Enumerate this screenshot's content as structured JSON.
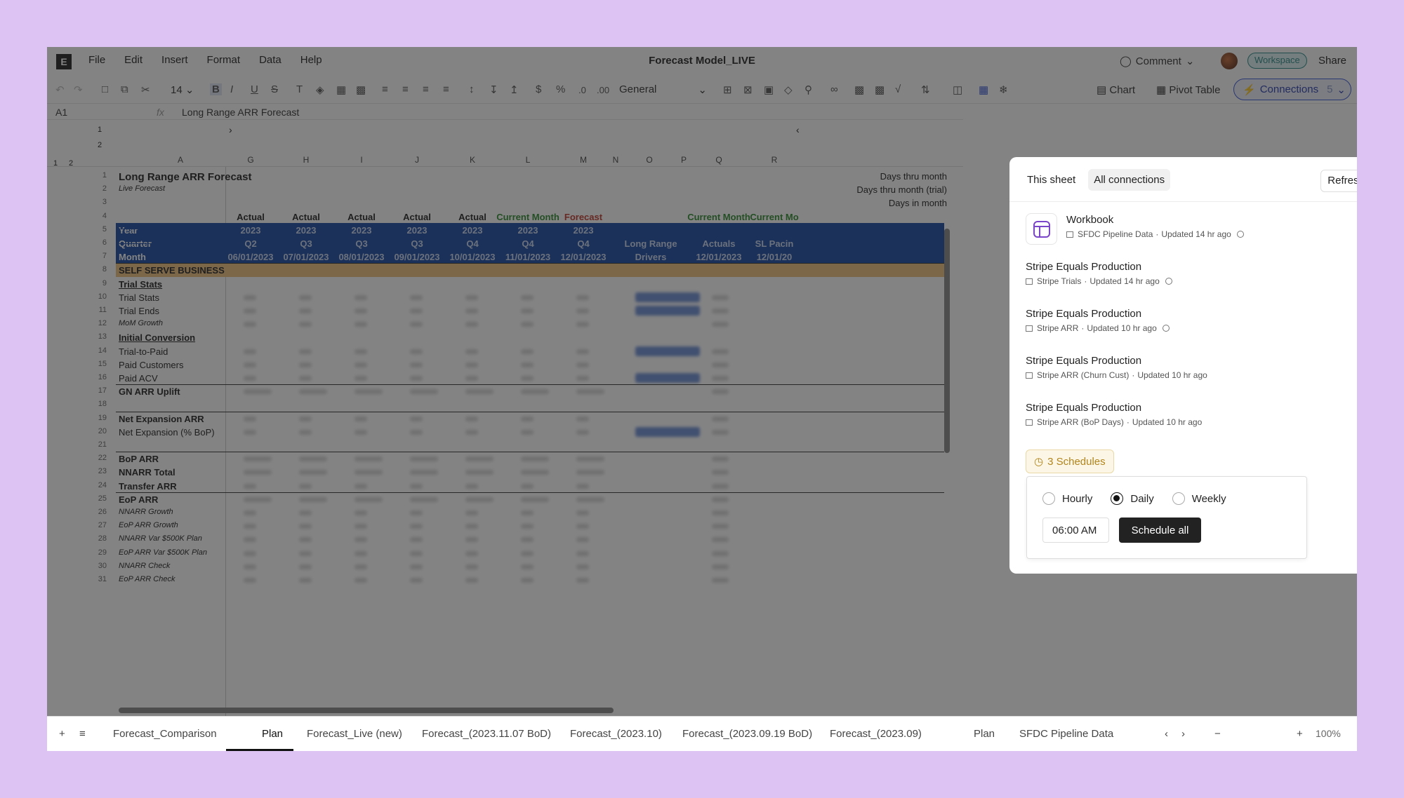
{
  "menubar": {
    "items": [
      "File",
      "Edit",
      "Insert",
      "Format",
      "Data",
      "Help"
    ],
    "title": "Forecast Model_LIVE",
    "comment": "Comment",
    "workspace": "Workspace",
    "share": "Share"
  },
  "toolbar": {
    "font_size": "14",
    "number_format": "General",
    "decimals_less": ".0",
    "decimals_more": ".00",
    "chart": "Chart",
    "pivot": "Pivot Table",
    "connections": "Connections",
    "connections_count": "5"
  },
  "formula": {
    "cell": "A1",
    "fx": "fx",
    "value": "Long Range ARR Forecast"
  },
  "grid": {
    "outline_levels": [
      "1",
      "2"
    ],
    "columns": [
      "A",
      "G",
      "H",
      "I",
      "J",
      "K",
      "L",
      "M",
      "N",
      "O",
      "P",
      "Q",
      "R"
    ],
    "header_row_numbers": [
      "1",
      "2"
    ],
    "rows": [
      {
        "n": "1",
        "a": "Long Range ARR Forecast"
      },
      {
        "n": "2",
        "a": "Live Forecast"
      },
      {
        "n": "3",
        "a": ""
      },
      {
        "n": "4",
        "a": ""
      },
      {
        "n": "5",
        "a": "Year"
      },
      {
        "n": "6",
        "a": "Quarter"
      },
      {
        "n": "7",
        "a": "Month"
      },
      {
        "n": "8",
        "a": "SELF SERVE BUSINESS"
      },
      {
        "n": "9",
        "a": "Trial Stats"
      },
      {
        "n": "10",
        "a": "Trial Stats"
      },
      {
        "n": "11",
        "a": "Trial Ends"
      },
      {
        "n": "12",
        "a": "MoM Growth"
      },
      {
        "n": "13",
        "a": "Initial Conversion"
      },
      {
        "n": "14",
        "a": "Trial-to-Paid"
      },
      {
        "n": "15",
        "a": "Paid Customers"
      },
      {
        "n": "16",
        "a": "Paid ACV"
      },
      {
        "n": "17",
        "a": "GN ARR Uplift"
      },
      {
        "n": "18",
        "a": ""
      },
      {
        "n": "19",
        "a": "Net Expansion ARR"
      },
      {
        "n": "20",
        "a": "Net Expansion (% BoP)"
      },
      {
        "n": "21",
        "a": ""
      },
      {
        "n": "22",
        "a": "BoP ARR"
      },
      {
        "n": "23",
        "a": "NNARR Total"
      },
      {
        "n": "24",
        "a": "Transfer ARR"
      },
      {
        "n": "25",
        "a": "EoP ARR"
      },
      {
        "n": "26",
        "a": "NNARR Growth"
      },
      {
        "n": "27",
        "a": "EoP ARR Growth"
      },
      {
        "n": "28",
        "a": "NNARR Var $500K Plan"
      },
      {
        "n": "29",
        "a": "EoP ARR Var $500K Plan"
      },
      {
        "n": "30",
        "a": "NNARR Check"
      },
      {
        "n": "31",
        "a": "EoP ARR Check"
      }
    ],
    "right_labels": [
      "Days thru month",
      "Days thru month (trial)",
      "Days in month"
    ],
    "status_row": [
      "Actual",
      "Actual",
      "Actual",
      "Actual",
      "Actual",
      "Current Month",
      "Forecast"
    ],
    "status_right": [
      "Current Month",
      "Current Mo"
    ],
    "years": [
      "2023",
      "2023",
      "2023",
      "2023",
      "2023",
      "2023",
      "2023"
    ],
    "quarters": [
      "Q2",
      "Q3",
      "Q3",
      "Q3",
      "Q4",
      "Q4",
      "Q4"
    ],
    "months": [
      "06/01/2023",
      "07/01/2023",
      "08/01/2023",
      "09/01/2023",
      "10/01/2023",
      "11/01/2023",
      "12/01/2023"
    ],
    "band_right_top": [
      "Long Range",
      "Actuals",
      "SL Pacin"
    ],
    "band_right_bottom": [
      "Drivers",
      "12/01/2023",
      "12/01/20"
    ],
    "colors": {
      "actual": "#222222",
      "current": "#2e8b2e",
      "forecast": "#c0392b",
      "band": "#1a4aa3",
      "tan": "#f2c27e"
    }
  },
  "tabs": {
    "items": [
      "Forecast_Comparison",
      "Plan",
      "Forecast_Live (new)",
      "Forecast_(2023.11.07 BoD)",
      "Forecast_(2023.10)",
      "Forecast_(2023.09.19 BoD)",
      "Forecast_(2023.09)",
      "Plan",
      "SFDC Pipeline Data"
    ],
    "zoom": "100%"
  },
  "panel": {
    "tab_this": "This sheet",
    "tab_all": "All connections",
    "refresh_all": "Refresh all",
    "connections": [
      {
        "title": "Workbook",
        "source": "SFDC Pipeline Data",
        "updated": "Updated 14 hr ago"
      },
      {
        "title": "Stripe Equals Production",
        "source": "Stripe Trials",
        "updated": "Updated 14 hr ago"
      },
      {
        "title": "Stripe Equals Production",
        "source": "Stripe ARR",
        "updated": "Updated 10 hr ago"
      },
      {
        "title": "Stripe Equals Production",
        "source": "Stripe ARR (Churn Cust)",
        "updated": "Updated 10 hr ago"
      },
      {
        "title": "Stripe Equals Production",
        "source": "Stripe ARR (BoP Days)",
        "updated": "Updated 10 hr ago"
      }
    ],
    "schedules_label": "3 Schedules",
    "frequency": {
      "hourly": "Hourly",
      "daily": "Daily",
      "weekly": "Weekly",
      "selected": "Daily"
    },
    "time_value": "06:00 AM",
    "schedule_all": "Schedule all"
  }
}
